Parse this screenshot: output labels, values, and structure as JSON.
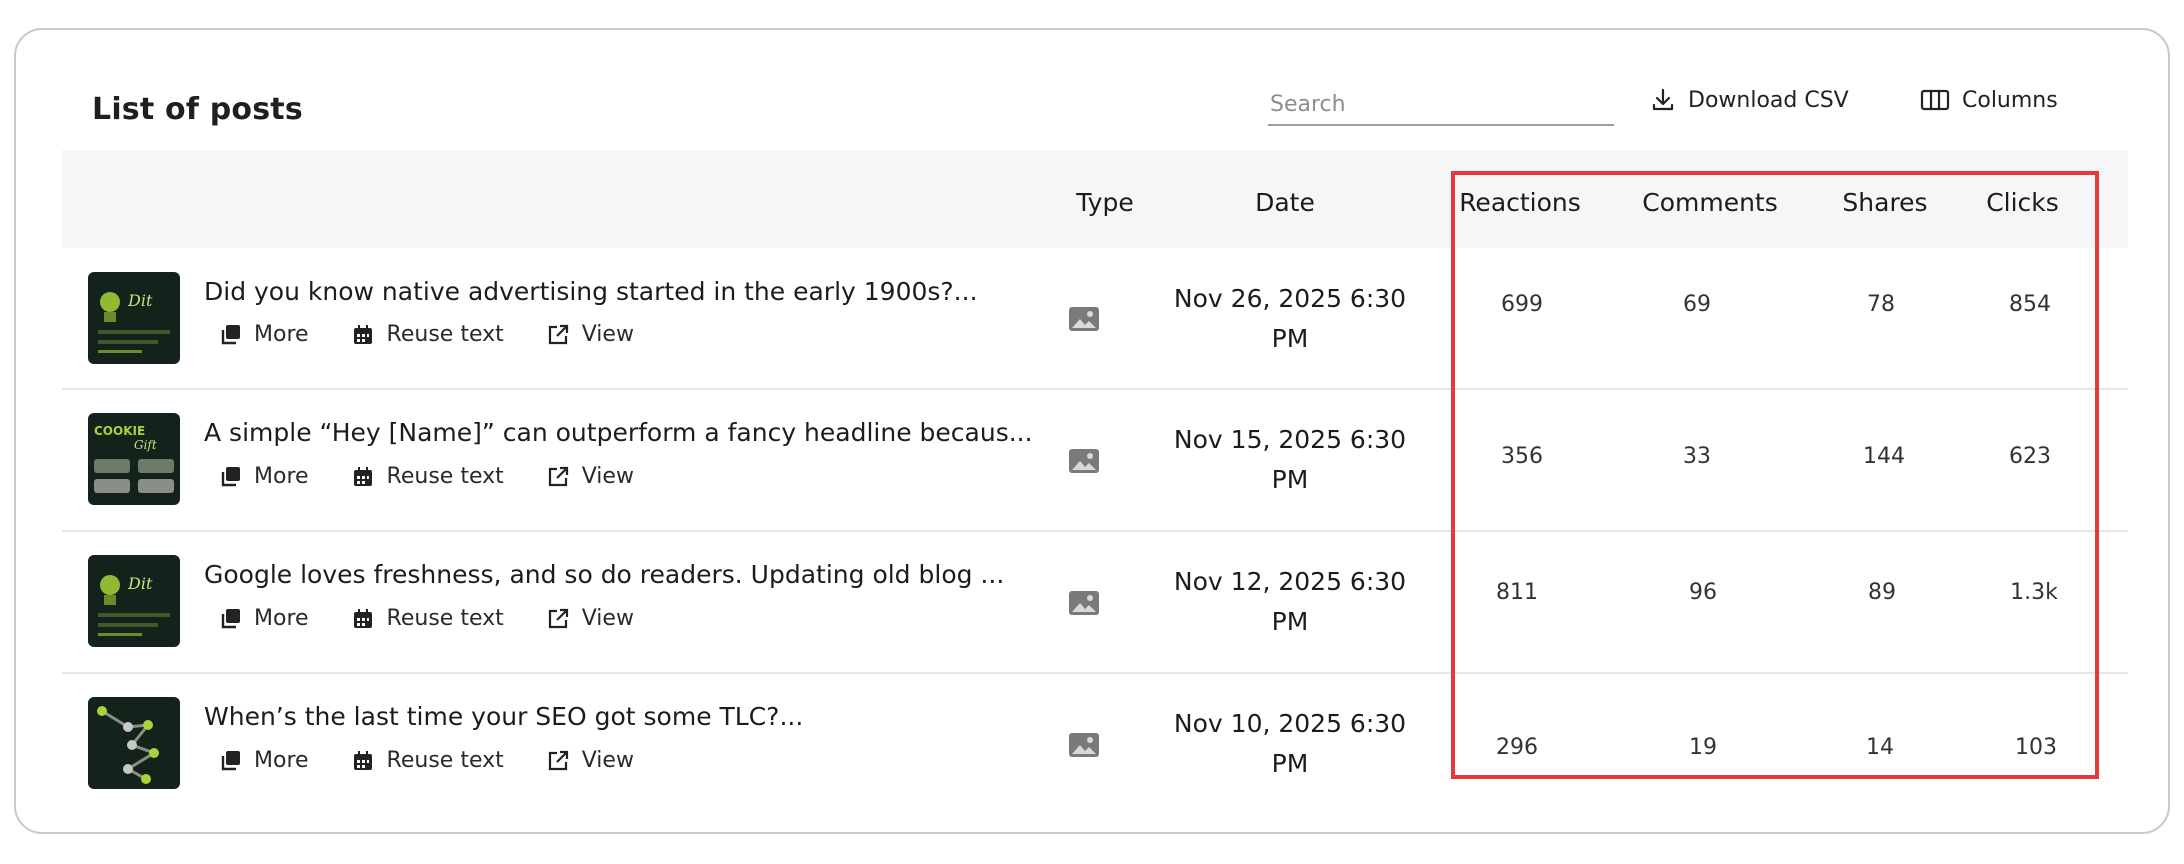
{
  "header": {
    "title": "List of posts",
    "search_placeholder": "Search",
    "download_label": "Download CSV",
    "columns_label": "Columns"
  },
  "table": {
    "columns": [
      "Type",
      "Date",
      "Reactions",
      "Comments",
      "Shares",
      "Clicks"
    ],
    "action_labels": {
      "more": "More",
      "reuse": "Reuse text",
      "view": "View"
    },
    "rows": [
      {
        "title": "Did you know native advertising started in the early 1900s?...",
        "date_line1": "Nov 26, 2025 6:30",
        "date_line2": "PM",
        "reactions": "699",
        "comments": "69",
        "shares": "78",
        "clicks": "854"
      },
      {
        "title": "A simple “Hey [Name]” can outperform a fancy headline becaus...",
        "date_line1": "Nov 15, 2025 6:30",
        "date_line2": "PM",
        "reactions": "356",
        "comments": "33",
        "shares": "144",
        "clicks": "623"
      },
      {
        "title": "Google loves freshness, and so do readers. Updating old blog ...",
        "date_line1": "Nov 12, 2025 6:30",
        "date_line2": "PM",
        "reactions": "811",
        "comments": "96",
        "shares": "89",
        "clicks": "1.3k"
      },
      {
        "title": "When’s the last time your SEO got some TLC?...",
        "date_line1": "Nov 10, 2025 6:30",
        "date_line2": "PM",
        "reactions": "296",
        "comments": "19",
        "shares": "14",
        "clicks": "103"
      }
    ]
  },
  "colors": {
    "highlight": "#e5393b",
    "header_bg": "#f6f6f8",
    "thumb_bg": "#13221a",
    "thumb_accent": "#a7d43a"
  }
}
